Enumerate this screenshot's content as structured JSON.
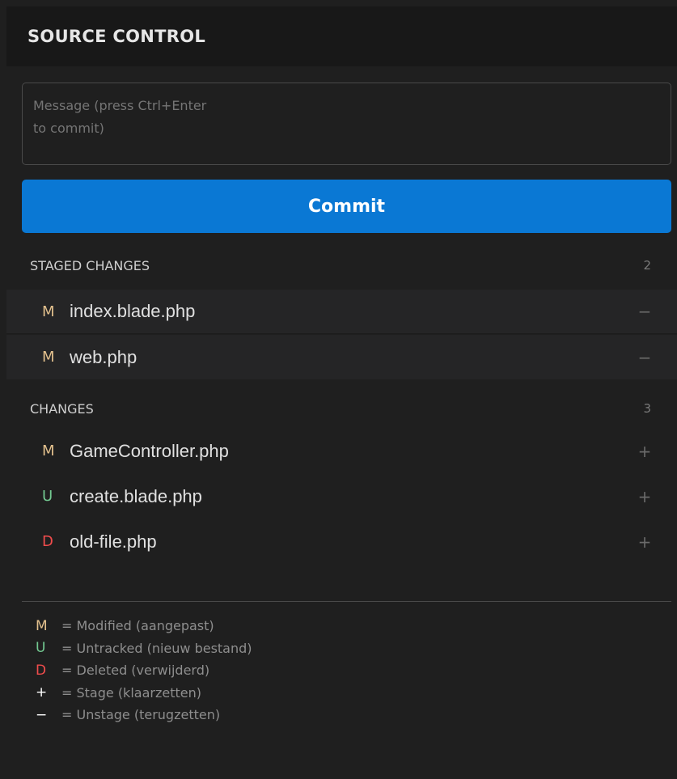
{
  "panel": {
    "title": "SOURCE CONTROL"
  },
  "commit_message": {
    "placeholder": "Message (press Ctrl+Enter\nto commit)",
    "value": ""
  },
  "commit_button": {
    "label": "Commit"
  },
  "staged": {
    "label": "STAGED CHANGES",
    "count": "2",
    "files": [
      {
        "status": "M",
        "name": "index.blade.php",
        "action": "−"
      },
      {
        "status": "M",
        "name": "web.php",
        "action": "−"
      }
    ]
  },
  "changes": {
    "label": "CHANGES",
    "count": "3",
    "files": [
      {
        "status": "M",
        "name": "GameController.php",
        "action": "+"
      },
      {
        "status": "U",
        "name": "create.blade.php",
        "action": "+"
      },
      {
        "status": "D",
        "name": "old-file.php",
        "action": "+"
      }
    ]
  },
  "legend": [
    {
      "key": "M",
      "text": "= Modified (aangepast)"
    },
    {
      "key": "U",
      "text": "= Untracked (nieuw bestand)"
    },
    {
      "key": "D",
      "text": "= Deleted (verwijderd)"
    },
    {
      "key": "+",
      "text": "= Stage (klaarzetten)"
    },
    {
      "key": "−",
      "text": "= Unstage (terugzetten)"
    }
  ],
  "colors": {
    "modified": "#e2c08d",
    "untracked": "#73c991",
    "deleted": "#f14c4c",
    "accent": "#0a78d4"
  }
}
